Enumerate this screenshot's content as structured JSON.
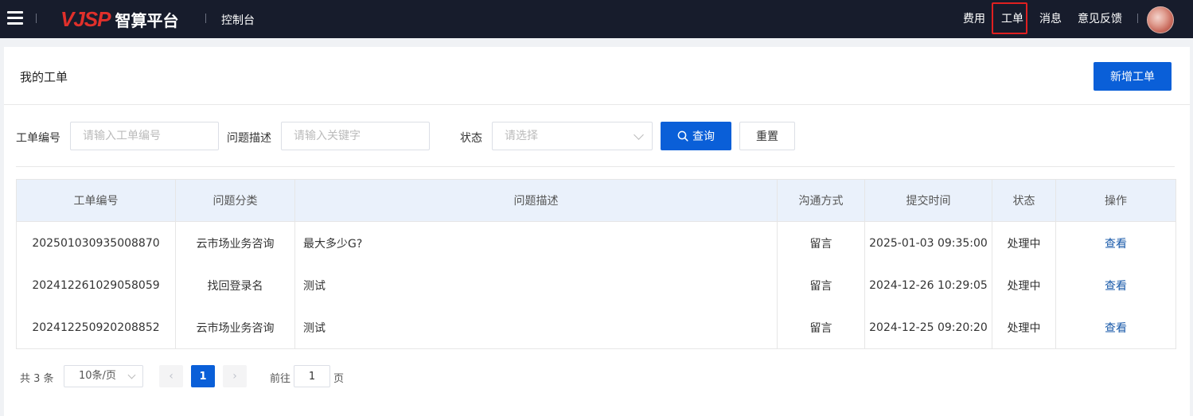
{
  "header": {
    "logo_mark": "VJSP",
    "logo_text": "智算平台",
    "console": "控制台",
    "nav": [
      "费用",
      "工单",
      "消息",
      "意见反馈"
    ]
  },
  "page": {
    "title": "我的工单",
    "add_button": "新增工单"
  },
  "filters": {
    "ticket_no_label": "工单编号",
    "ticket_no_placeholder": "请输入工单编号",
    "desc_label": "问题描述",
    "desc_placeholder": "请输入关键字",
    "status_label": "状态",
    "status_placeholder": "请选择",
    "search_button": "查询",
    "reset_button": "重置"
  },
  "table": {
    "columns": [
      "工单编号",
      "问题分类",
      "问题描述",
      "沟通方式",
      "提交时间",
      "状态",
      "操作"
    ],
    "rows": [
      {
        "id": "202501030935008870",
        "category": "云市场业务咨询",
        "desc": "最大多少G?",
        "channel": "留言",
        "time": "2025-01-03 09:35:00",
        "status": "处理中",
        "action": "查看"
      },
      {
        "id": "202412261029058059",
        "category": "找回登录名",
        "desc": "测试",
        "channel": "留言",
        "time": "2024-12-26 10:29:05",
        "status": "处理中",
        "action": "查看"
      },
      {
        "id": "202412250920208852",
        "category": "云市场业务咨询",
        "desc": "测试",
        "channel": "留言",
        "time": "2024-12-25 09:20:20",
        "status": "处理中",
        "action": "查看"
      }
    ]
  },
  "pagination": {
    "total": "共 3 条",
    "page_size": "10条/页",
    "current_page": "1",
    "goto_label": "前往",
    "goto_value": "1",
    "goto_suffix": "页"
  },
  "colors": {
    "topbar": "#171c2c",
    "primary": "#0a5fd8",
    "brand_red": "#e0302b",
    "highlight_box": "#e02020",
    "table_header": "#eaf1fb",
    "link": "#1859a9"
  },
  "icons": [
    "menu-icon",
    "search-icon",
    "chevron-down-icon",
    "chevron-left-icon",
    "chevron-right-icon"
  ]
}
